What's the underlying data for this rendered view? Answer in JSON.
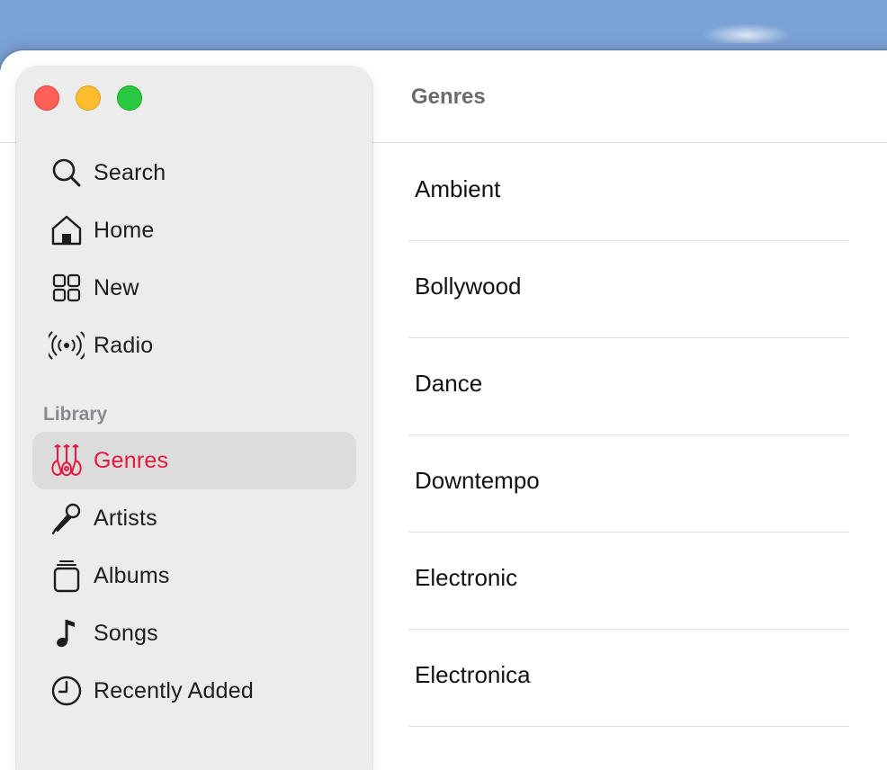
{
  "sidebar": {
    "items": [
      {
        "label": "Search",
        "icon": "search-icon"
      },
      {
        "label": "Home",
        "icon": "home-icon"
      },
      {
        "label": "New",
        "icon": "grid-icon"
      },
      {
        "label": "Radio",
        "icon": "radio-broadcast-icon"
      }
    ],
    "library_header": "Library",
    "library_items": [
      {
        "label": "Genres",
        "icon": "guitars-icon",
        "selected": true
      },
      {
        "label": "Artists",
        "icon": "microphone-icon"
      },
      {
        "label": "Albums",
        "icon": "album-stack-icon"
      },
      {
        "label": "Songs",
        "icon": "music-note-icon"
      },
      {
        "label": "Recently Added",
        "icon": "clock-icon"
      }
    ]
  },
  "main": {
    "title": "Genres",
    "genres": [
      "Ambient",
      "Bollywood",
      "Dance",
      "Downtempo",
      "Electronic",
      "Electronica"
    ]
  },
  "colors": {
    "accent": "#e8173c",
    "sidebar_bg": "#ececec",
    "selected_bg": "#dcdcdc",
    "close": "#fe5f57",
    "minimize": "#febc2e",
    "maximize": "#28c840"
  }
}
